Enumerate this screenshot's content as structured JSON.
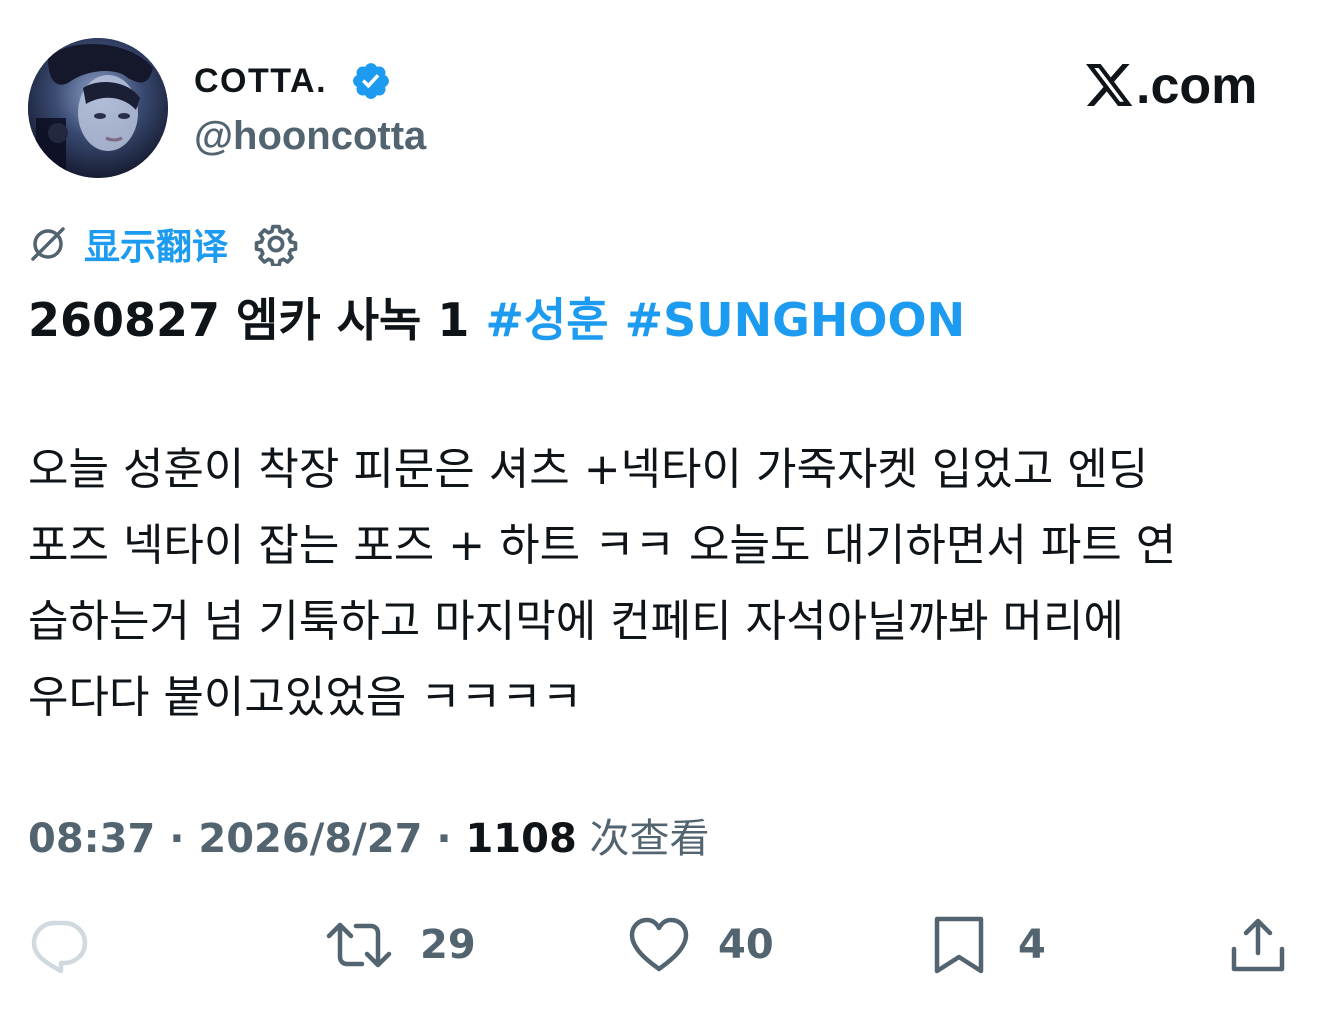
{
  "user": {
    "display_name": "COTTA.",
    "handle": "@hooncotta",
    "verified": true
  },
  "brand": {
    "logo_text": ".com"
  },
  "translate": {
    "label": "显示翻译"
  },
  "tweet": {
    "title_text": "260827 엠카 사녹 1 ",
    "hashtags": [
      "#성훈",
      "#SUNGHOON"
    ],
    "body_lines": [
      "오늘 성훈이 착장 피문은 셔츠 +넥타이 가죽자켓 입었고 엔딩",
      "포즈 넥타이 잡는 포즈 + 하트 ㅋㅋ 오늘도 대기하면서 파트 연",
      "습하는거 넘 기툭하고 마지막에 컨페티 자석아닐까봐 머리에",
      "우다다 붙이고있었음 ㅋㅋㅋㅋ"
    ]
  },
  "meta": {
    "time": "08:37",
    "separator": " · ",
    "date": "2026/8/27",
    "views_count": "1108",
    "views_label": " 次查看"
  },
  "actions": {
    "reply_count": "",
    "retweet_count": "29",
    "like_count": "40",
    "bookmark_count": "4"
  },
  "colors": {
    "accent": "#1d9bf0",
    "text_primary": "#0f1419",
    "text_secondary": "#536471",
    "reply_icon": "#cfd9de"
  }
}
